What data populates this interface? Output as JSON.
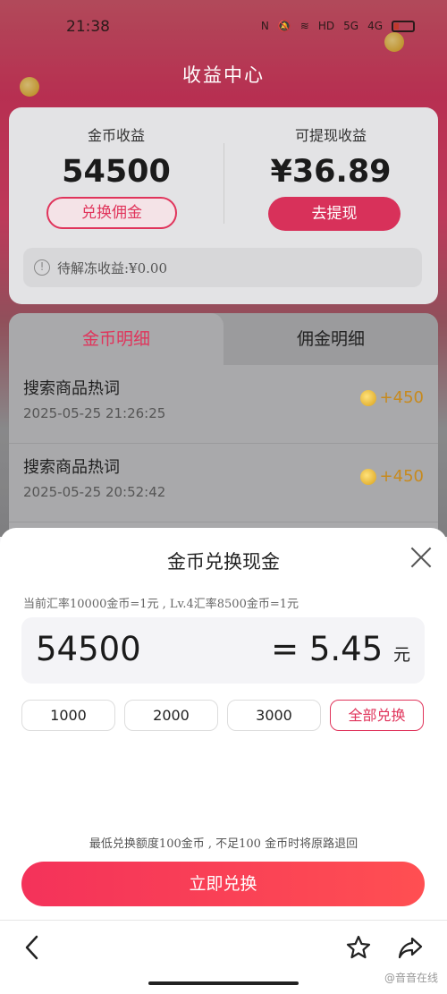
{
  "status_bar": {
    "time": "21:38",
    "icons": [
      "nfc-icon",
      "mute-icon",
      "wifi-icon",
      "hd-icon",
      "signal-5g-icon",
      "signal-4g-icon",
      "battery-icon"
    ],
    "net_5g": "5G",
    "net_4g": "4G",
    "hd": "HD"
  },
  "header": {
    "title": "收益中心"
  },
  "earnings": {
    "coin_label": "金币收益",
    "coin_value": "54500",
    "exchange_button": "兑换佣金",
    "cash_label": "可提现收益",
    "cash_value": "¥36.89",
    "withdraw_button": "去提现",
    "frozen_text": "待解冻收益:¥0.00"
  },
  "detail_tabs": {
    "coin_tab": "金币明细",
    "commission_tab": "佣金明细",
    "active": "coin_tab"
  },
  "coin_records": [
    {
      "title": "搜索商品热词",
      "time": "2025-05-25 21:26:25",
      "amount": "+450"
    },
    {
      "title": "搜索商品热词",
      "time": "2025-05-25 20:52:42",
      "amount": "+450"
    }
  ],
  "exchange_sheet": {
    "title": "金币兑换现金",
    "rate_text": "当前汇率10000金币=1元 , Lv.4汇率8500金币=1元",
    "input_value": "54500",
    "result_value": "= 5.45",
    "result_unit": "元",
    "chips": [
      "1000",
      "2000",
      "3000",
      "全部兑换"
    ],
    "selected_chip": "全部兑换",
    "min_note": "最低兑换额度100金币 , 不足100 金币时将原路退回",
    "submit_button": "立即兑换"
  },
  "bottom_nav": {
    "icons": [
      "back-icon",
      "star-icon",
      "share-icon"
    ]
  },
  "watermark": "@音音在线",
  "colors": {
    "accent": "#e0345b",
    "submit_gradient_start": "#f4325a",
    "submit_gradient_end": "#ff4f52",
    "coin_gold": "#c78a1e"
  }
}
